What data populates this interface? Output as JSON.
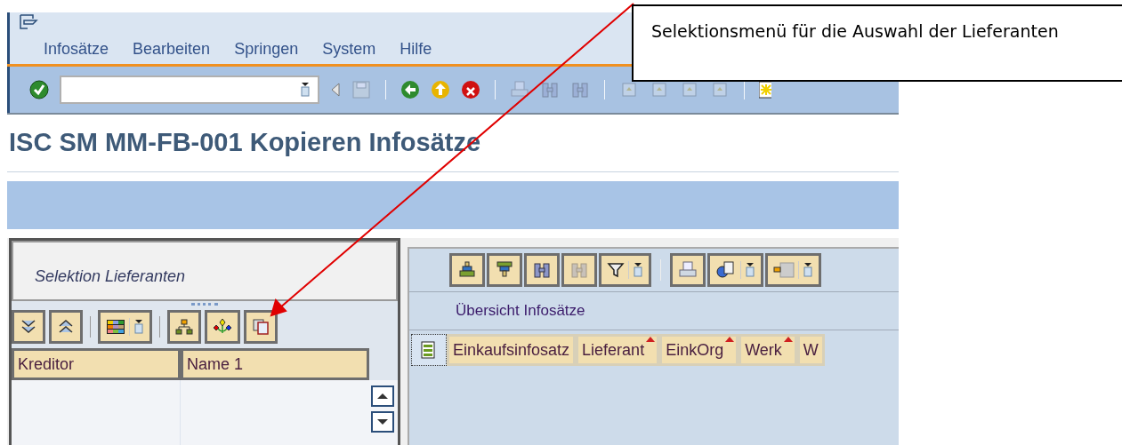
{
  "menu": [
    "Infosätze",
    "Bearbeiten",
    "Springen",
    "System",
    "Hilfe"
  ],
  "title": "ISC SM MM-FB-001 Kopieren Infosätze",
  "left_panel": {
    "heading": "Selektion Lieferanten",
    "columns": [
      "Kreditor",
      "Name 1"
    ]
  },
  "right_panel": {
    "heading": "Übersicht Infosätze",
    "columns": [
      {
        "label": "Einkaufsinfosatz",
        "marked": false
      },
      {
        "label": "Lieferant",
        "marked": true
      },
      {
        "label": "EinkOrg",
        "marked": true
      },
      {
        "label": "Werk",
        "marked": true
      },
      {
        "label": "W",
        "marked": false
      }
    ]
  },
  "callout": {
    "text": "Selektionsmenü für die Auswahl der Lieferanten"
  }
}
